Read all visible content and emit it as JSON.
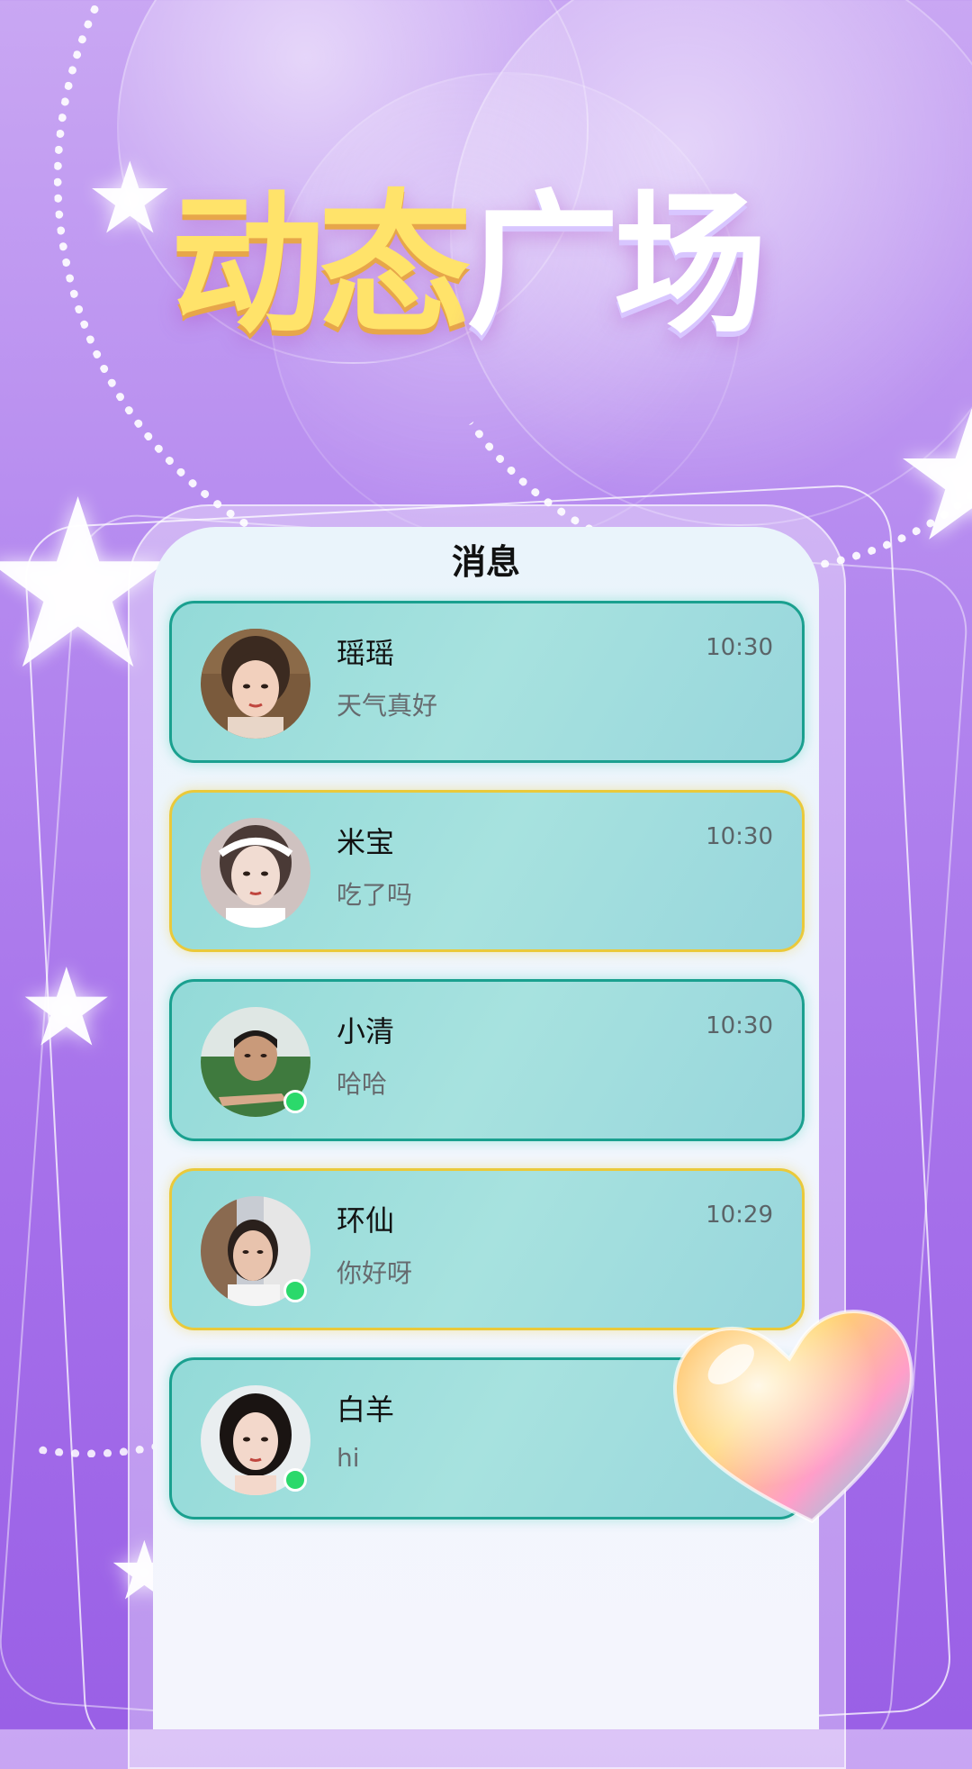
{
  "headline": {
    "part1": "动态",
    "part2": "广场"
  },
  "screen": {
    "title": "消息"
  },
  "messages": [
    {
      "name": "瑶瑶",
      "text": "天气真好",
      "time": "10:30",
      "online": false,
      "border": "teal"
    },
    {
      "name": "米宝",
      "text": "吃了吗",
      "time": "10:30",
      "online": false,
      "border": "gold"
    },
    {
      "name": "小清",
      "text": "哈哈",
      "time": "10:30",
      "online": true,
      "border": "teal"
    },
    {
      "name": "环仙",
      "text": "你好呀",
      "time": "10:29",
      "online": true,
      "border": "gold"
    },
    {
      "name": "白羊",
      "text": "hi",
      "time": "",
      "online": true,
      "border": "teal"
    }
  ],
  "colors": {
    "headline_yellow": "#ffe36a",
    "card_teal_border": "#1aa08f",
    "card_gold_border": "#eac93a",
    "online_green": "#2bd96b",
    "background_purple": "#b488ef"
  },
  "icons": {
    "heart": "glossy-heart-icon",
    "star": "star-icon"
  }
}
